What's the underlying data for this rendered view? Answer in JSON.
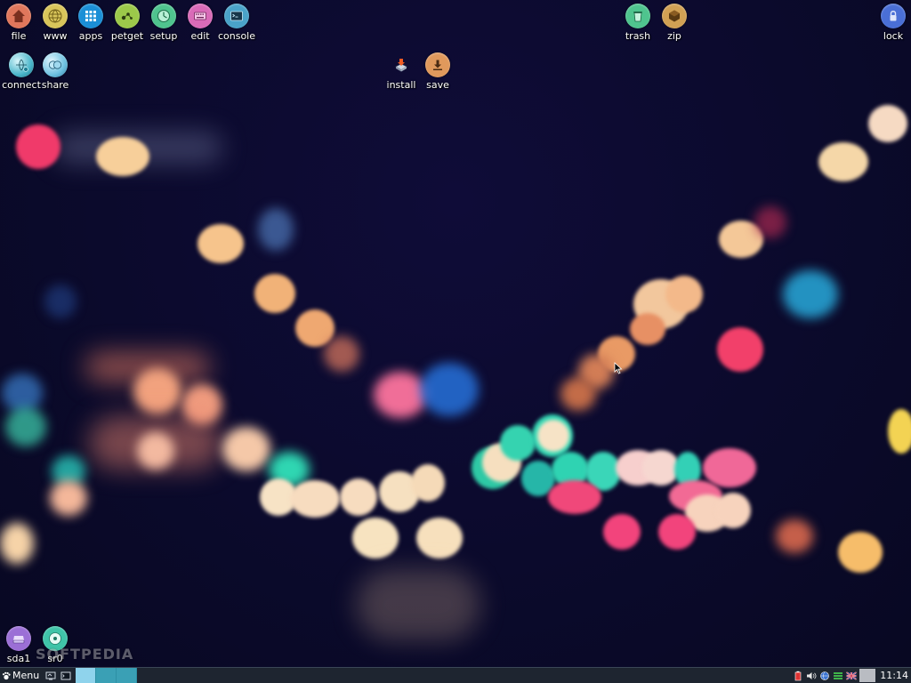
{
  "desktop": {
    "icons_top_left": [
      {
        "label": "file",
        "icon": "home-icon",
        "color": "#e0775c"
      },
      {
        "label": "www",
        "icon": "globe-icon",
        "color": "#d8c55a"
      },
      {
        "label": "apps",
        "icon": "grid-icon",
        "color": "#1b8fd6"
      },
      {
        "label": "petget",
        "icon": "package-icon",
        "color": "#9cc94a"
      },
      {
        "label": "setup",
        "icon": "clock-icon",
        "color": "#4fc48e"
      },
      {
        "label": "edit",
        "icon": "keyboard-icon",
        "color": "#d96bb8"
      },
      {
        "label": "console",
        "icon": "terminal-icon",
        "color": "#4aa3c9"
      }
    ],
    "icons_second_row": [
      {
        "label": "connect",
        "icon": "network-icon",
        "color": "#48b5c9"
      },
      {
        "label": "share",
        "icon": "share-icon",
        "color": "#6dc1e0"
      }
    ],
    "icons_center": [
      {
        "label": "install",
        "icon": "install-icon",
        "color": "#e8552a"
      },
      {
        "label": "save",
        "icon": "download-icon",
        "color": "#e0995c"
      }
    ],
    "icons_top_right": [
      {
        "label": "trash",
        "icon": "trash-icon",
        "color": "#4fc48e"
      },
      {
        "label": "zip",
        "icon": "archive-icon",
        "color": "#d1a154"
      }
    ],
    "icons_far_right": [
      {
        "label": "lock",
        "icon": "padlock-icon",
        "color": "#4a6fd6"
      }
    ],
    "drive_icons": [
      {
        "label": "sda1",
        "icon": "drive-icon",
        "color": "#9b6fd6"
      },
      {
        "label": "sr0",
        "icon": "optical-disc-icon",
        "color": "#3fc4a8"
      }
    ],
    "watermark": "SOFTPEDIA"
  },
  "taskbar": {
    "menu_label": "Menu",
    "clock": "11:14",
    "pager": [
      {
        "workspace": 1,
        "state": "active"
      },
      {
        "workspace": 2,
        "state": "inactive"
      },
      {
        "workspace": 3,
        "state": "inactive"
      }
    ]
  }
}
